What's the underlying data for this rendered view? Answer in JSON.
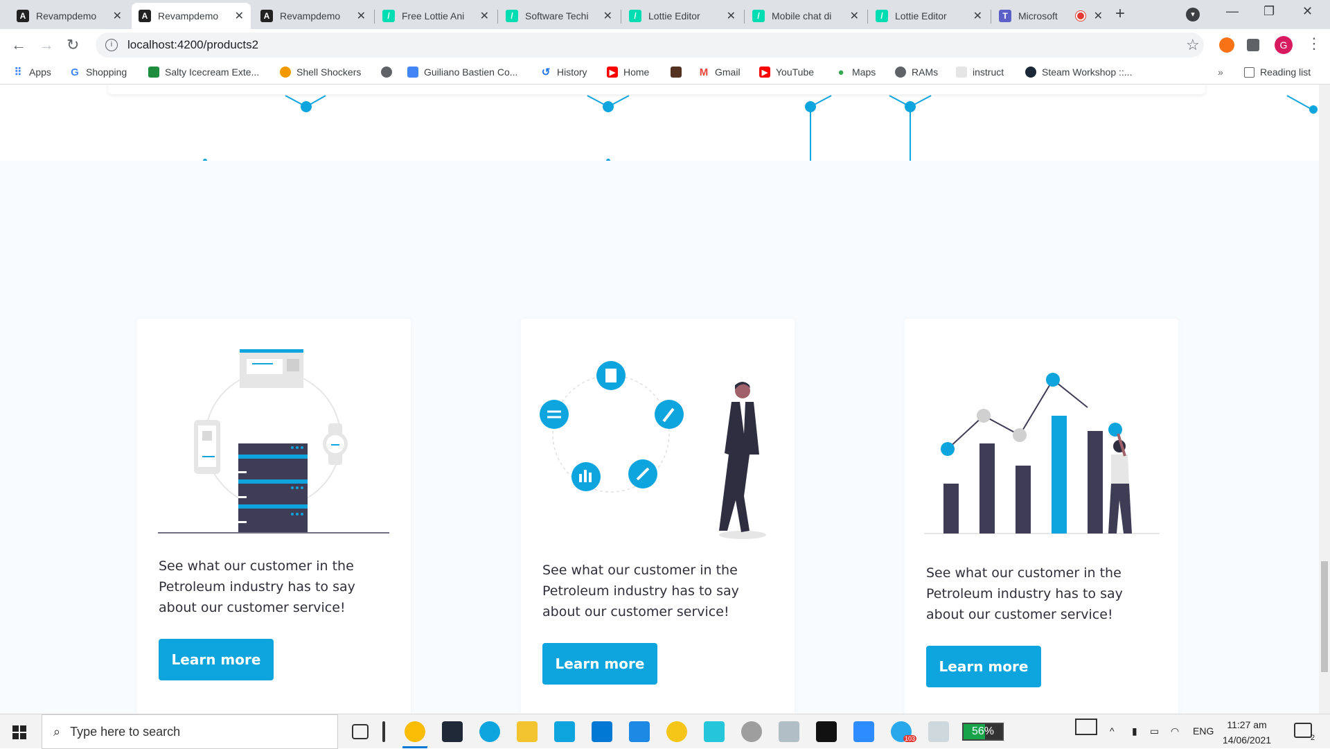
{
  "browser": {
    "tabs": [
      {
        "title": "Revampdemo",
        "favicon": "angular-icon",
        "active": false
      },
      {
        "title": "Revampdemo",
        "favicon": "angular-icon",
        "active": true
      },
      {
        "title": "Revampdemo",
        "favicon": "angular-icon",
        "active": false
      },
      {
        "title": "Free Lottie Ani",
        "favicon": "lottie-icon",
        "active": false
      },
      {
        "title": "Software Techi",
        "favicon": "lottie-icon",
        "active": false
      },
      {
        "title": "Lottie Editor",
        "favicon": "lottie-icon",
        "active": false
      },
      {
        "title": "Mobile chat di",
        "favicon": "lottie-icon",
        "active": false
      },
      {
        "title": "Lottie Editor",
        "favicon": "lottie-icon",
        "active": false
      },
      {
        "title": "Microsoft",
        "favicon": "teams-icon",
        "active": false
      }
    ],
    "url": "localhost:4200/products2",
    "profile_initial": "G",
    "bookmarks": [
      {
        "label": "Apps",
        "icon": "apps-grid-icon",
        "color": "#4285f4"
      },
      {
        "label": "Shopping",
        "icon": "google-icon",
        "color": "#4285f4"
      },
      {
        "label": "Salty Icecream Exte...",
        "icon": "extension-icon",
        "color": "#1e8e3e"
      },
      {
        "label": "Shell Shockers",
        "icon": "egg-icon",
        "color": "#f29900"
      },
      {
        "label": "",
        "icon": "globe-icon",
        "color": "#5f6368"
      },
      {
        "label": "Guiliano Bastien Co...",
        "icon": "docs-icon",
        "color": "#4285f4"
      },
      {
        "label": "History",
        "icon": "history-icon",
        "color": "#1a73e8"
      },
      {
        "label": "Home",
        "icon": "youtube-icon",
        "color": "#ff0000"
      },
      {
        "label": "",
        "icon": "photo-icon",
        "color": "#553322"
      },
      {
        "label": "Gmail",
        "icon": "gmail-icon",
        "color": "#ea4335"
      },
      {
        "label": "YouTube",
        "icon": "youtube-icon",
        "color": "#ff0000"
      },
      {
        "label": "Maps",
        "icon": "maps-pin-icon",
        "color": "#34a853"
      },
      {
        "label": "RAMs",
        "icon": "globe-icon",
        "color": "#5f6368"
      },
      {
        "label": "instruct",
        "icon": "wing-icon",
        "color": "#bbbbbb"
      },
      {
        "label": "Steam Workshop ::...",
        "icon": "steam-icon",
        "color": "#1b2838"
      }
    ],
    "reading_list": "Reading list"
  },
  "cards": [
    {
      "text": "See what our customer in the Petroleum industry has to say about our customer service!",
      "button": "Learn more",
      "illustration": "server-network-illustration"
    },
    {
      "text": "See what our customer in the Petroleum industry has to say about our customer service!",
      "button": "Learn more",
      "illustration": "businessman-cycle-illustration"
    },
    {
      "text": "See what our customer in the Petroleum industry has to say about our customer service!",
      "button": "Learn more",
      "illustration": "growth-chart-illustration"
    }
  ],
  "colors": {
    "accent": "#0ea5de",
    "dark": "#3f3d56"
  },
  "taskbar": {
    "search_placeholder": "Type here to search",
    "battery": "56%",
    "battery_level": 0.56,
    "language": "ENG",
    "time": "11:27 am",
    "date": "14/06/2021",
    "notifications": "2",
    "telegram_badge": "103"
  }
}
